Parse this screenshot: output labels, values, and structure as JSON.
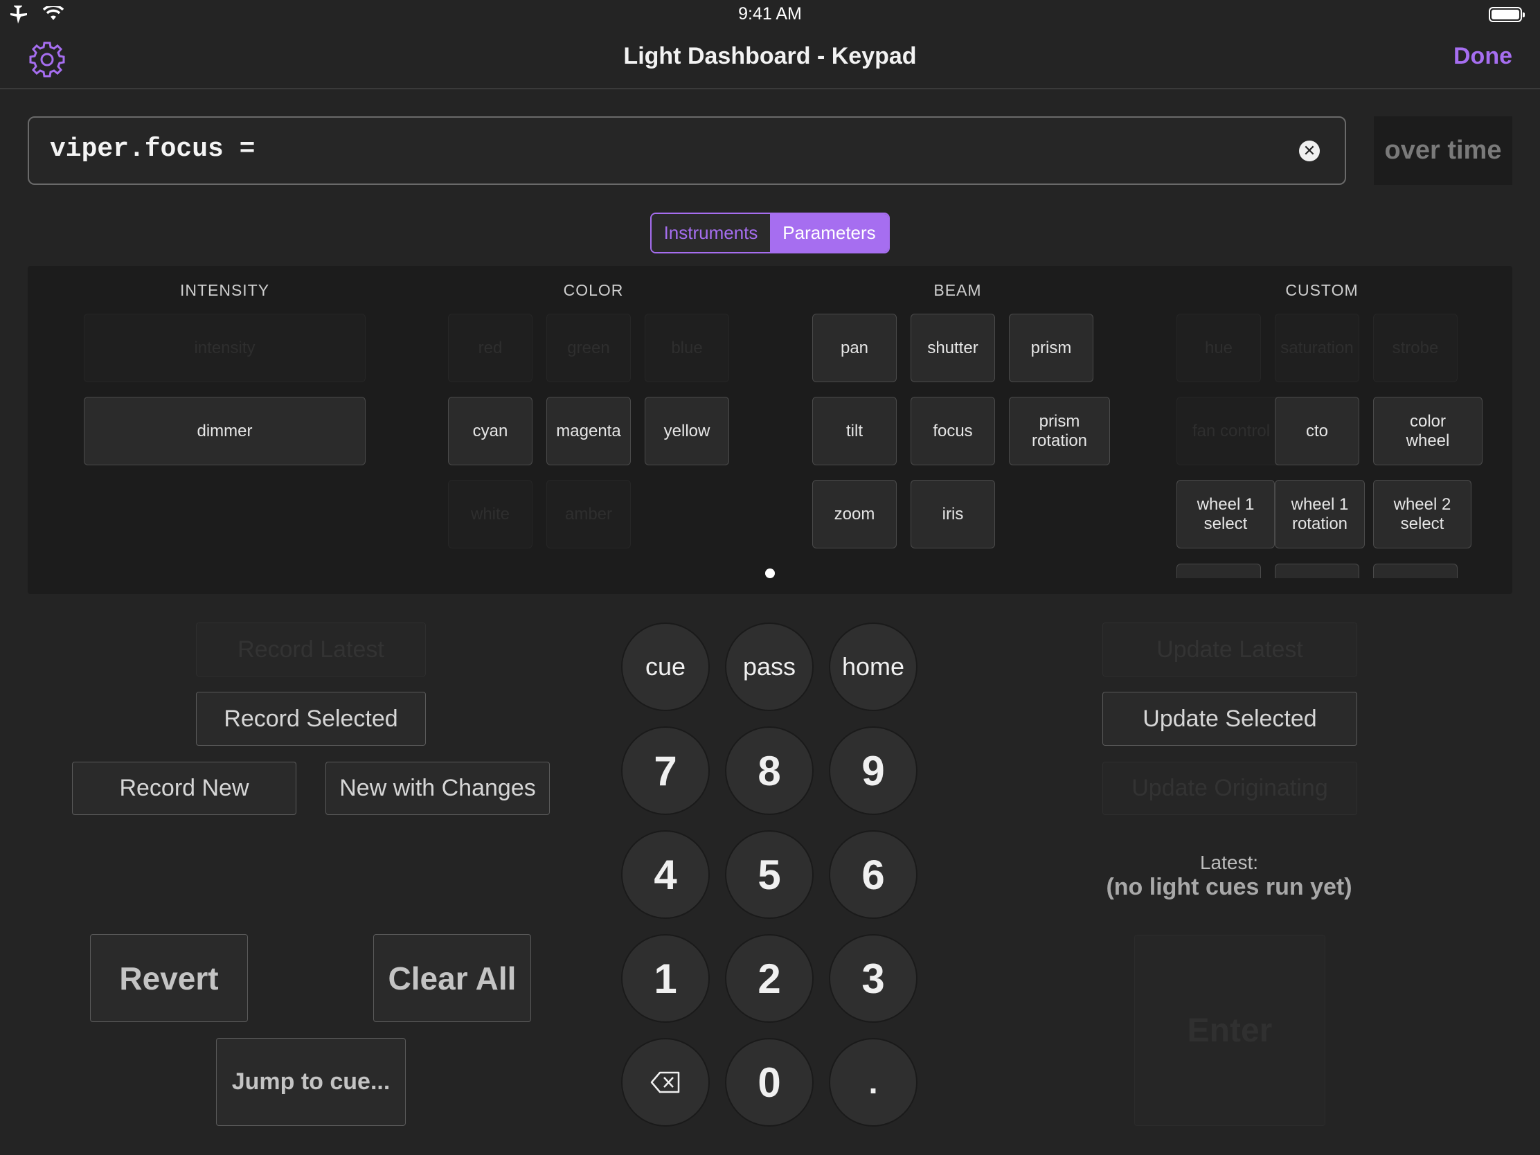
{
  "status_bar": {
    "time": "9:41 AM"
  },
  "nav": {
    "title": "Light Dashboard - Keypad",
    "done_label": "Done"
  },
  "command": {
    "text": "viper.focus =",
    "over_time_label": "over time"
  },
  "segments": {
    "instruments": "Instruments",
    "parameters": "Parameters",
    "selected": "Parameters"
  },
  "params": {
    "intensity": {
      "heading": "INTENSITY",
      "intensity": "intensity",
      "dimmer": "dimmer"
    },
    "color": {
      "heading": "COLOR",
      "red": "red",
      "green": "green",
      "blue": "blue",
      "cyan": "cyan",
      "magenta": "magenta",
      "yellow": "yellow",
      "white": "white",
      "amber": "amber"
    },
    "beam": {
      "heading": "BEAM",
      "pan": "pan",
      "shutter": "shutter",
      "prism": "prism",
      "tilt": "tilt",
      "focus": "focus",
      "prism_rotation": "prism rotation",
      "zoom": "zoom",
      "iris": "iris"
    },
    "custom": {
      "heading": "CUSTOM",
      "hue": "hue",
      "saturation": "saturation",
      "strobe": "strobe",
      "fan_control": "fan control",
      "cto": "cto",
      "color_wheel": "color wheel",
      "wheel1_select": "wheel 1 select",
      "wheel1_rotation": "wheel 1 rotation",
      "wheel2_select": "wheel 2 select"
    }
  },
  "actions": {
    "record_latest": "Record Latest",
    "record_selected": "Record Selected",
    "record_new": "Record New",
    "new_with_changes": "New with Changes",
    "revert": "Revert",
    "clear_all": "Clear All",
    "jump_to_cue": "Jump to cue...",
    "update_latest": "Update Latest",
    "update_selected": "Update Selected",
    "update_originating": "Update Originating",
    "enter": "Enter"
  },
  "keypad": {
    "cue": "cue",
    "pass": "pass",
    "home": "home",
    "k7": "7",
    "k8": "8",
    "k9": "9",
    "k4": "4",
    "k5": "5",
    "k6": "6",
    "k1": "1",
    "k2": "2",
    "k3": "3",
    "k0": "0",
    "dot": "."
  },
  "latest": {
    "label": "Latest:",
    "value": "(no light cues run yet)"
  },
  "colors": {
    "accent": "#a66ef0",
    "background": "#242424",
    "panel": "#1c1c1c"
  },
  "icons": [
    "airplane-icon",
    "wifi-icon",
    "battery-icon",
    "gear-icon",
    "clear-icon",
    "backspace-icon"
  ]
}
